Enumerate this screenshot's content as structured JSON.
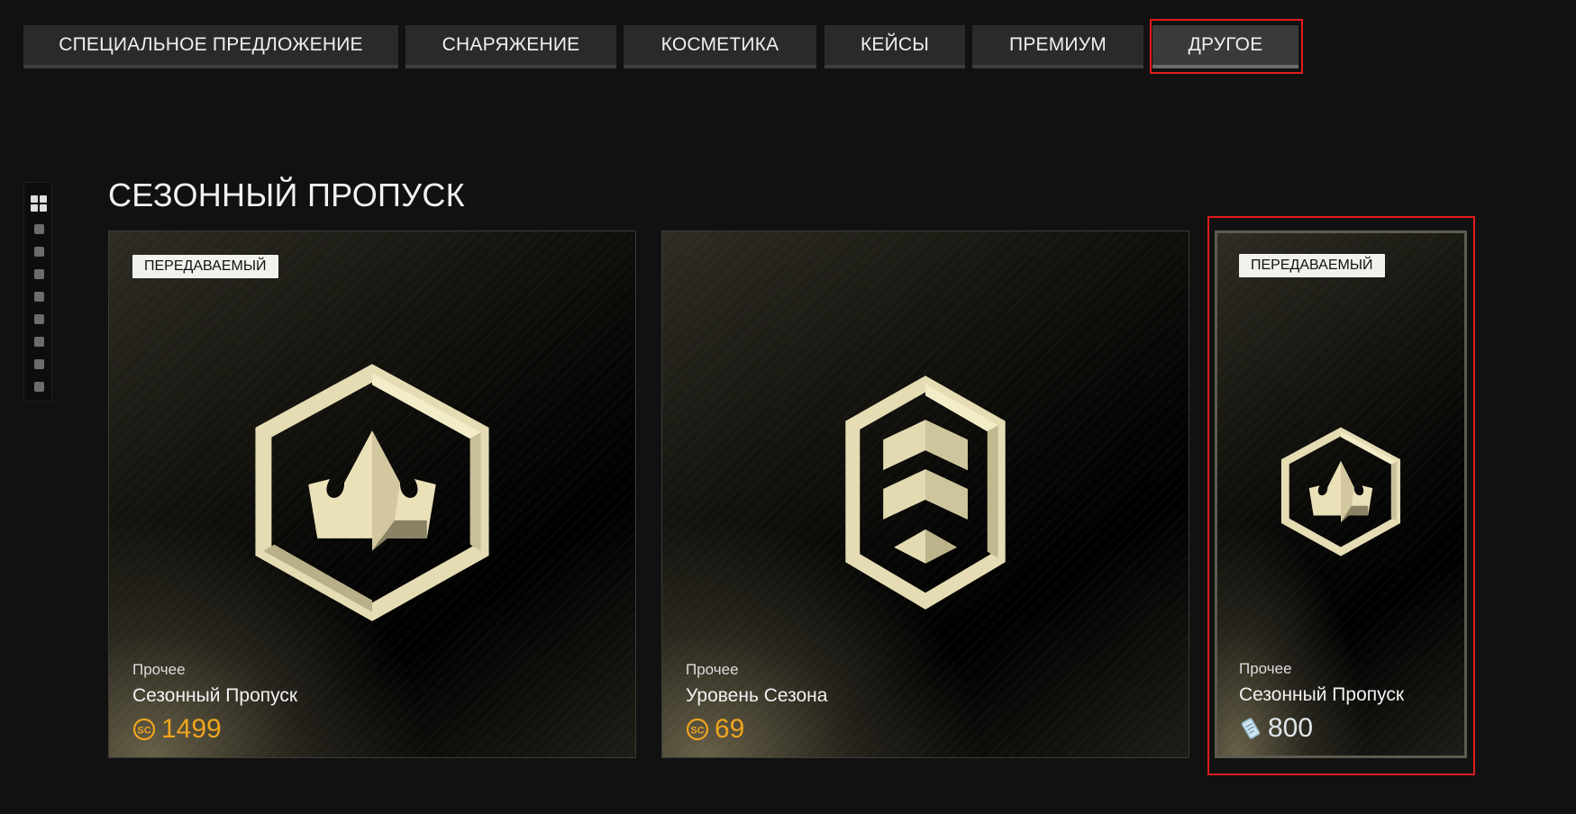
{
  "tabs": [
    {
      "label": "СПЕЦИАЛЬНОЕ ПРЕДЛОЖЕНИЕ"
    },
    {
      "label": "СНАРЯЖЕНИЕ"
    },
    {
      "label": "КОСМЕТИКА"
    },
    {
      "label": "КЕЙСЫ"
    },
    {
      "label": "ПРЕМИУМ"
    },
    {
      "label": "ДРУГОЕ",
      "active": true
    }
  ],
  "section": {
    "title": "СЕЗОННЫЙ ПРОПУСК"
  },
  "cards": [
    {
      "badge": "ПЕРЕДАВАЕМЫЙ",
      "category": "Прочее",
      "name": "Сезонный Пропуск",
      "price": "1499",
      "currency_icon": "sc-coin-icon",
      "art_icon": "crown-hexagon-icon"
    },
    {
      "badge": "",
      "category": "Прочее",
      "name": "Уровень Сезона",
      "price": "69",
      "currency_icon": "sc-coin-icon",
      "art_icon": "chevron-rank-icon"
    },
    {
      "badge": "ПЕРЕДАВАЕМЫЙ",
      "category": "Прочее",
      "name": "Сезонный Пропуск",
      "price": "800",
      "currency_icon": "ticket-icon",
      "art_icon": "crown-hexagon-icon",
      "selected": true
    }
  ],
  "colors": {
    "accent_gold": "#f0a51e",
    "selection": "#e01b1b",
    "emblem": "#e6dcb4"
  },
  "sc_label": "SC"
}
